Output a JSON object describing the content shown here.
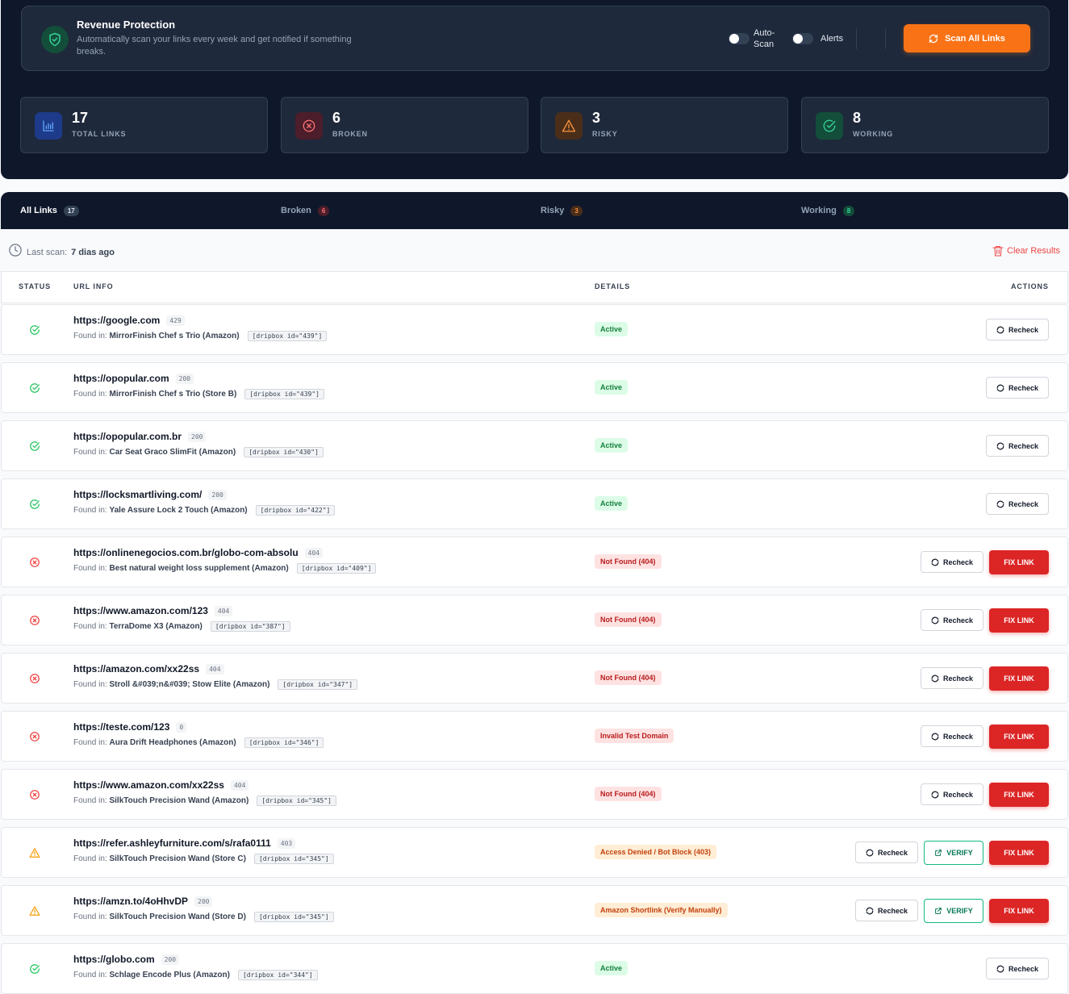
{
  "protection": {
    "title": "Revenue Protection",
    "description": "Automatically scan your links every week and get notified if something breaks.",
    "auto_scan_label": "Auto-Scan",
    "alerts_label": "Alerts",
    "scan_button": "Scan All Links"
  },
  "stats": [
    {
      "value": "17",
      "label": "TOTAL LINKS"
    },
    {
      "value": "6",
      "label": "BROKEN"
    },
    {
      "value": "3",
      "label": "RISKY"
    },
    {
      "value": "8",
      "label": "WORKING"
    }
  ],
  "tabs": [
    {
      "label": "All Links",
      "count": "17"
    },
    {
      "label": "Broken",
      "count": "6"
    },
    {
      "label": "Risky",
      "count": "3"
    },
    {
      "label": "Working",
      "count": "8"
    }
  ],
  "meta": {
    "last_scan_prefix": "Last scan:",
    "last_scan_value": "7 dias ago",
    "clear_results": "Clear Results"
  },
  "table": {
    "headers": {
      "status": "STATUS",
      "url": "URL INFO",
      "details": "DETAILS",
      "actions": "ACTIONS"
    },
    "found_prefix": "Found in:",
    "recheck_label": "Recheck",
    "fix_label": "FIX LINK",
    "verify_label": "VERIFY",
    "rows": [
      {
        "status": "ok",
        "url": "https://google.com",
        "code": "429",
        "found": "MirrorFinish Chef s Trio (Amazon)",
        "shortcode": "[dripbox id=\"439\"]",
        "detail": "Active"
      },
      {
        "status": "ok",
        "url": "https://opopular.com",
        "code": "200",
        "found": "MirrorFinish Chef s Trio (Store B)",
        "shortcode": "[dripbox id=\"439\"]",
        "detail": "Active"
      },
      {
        "status": "ok",
        "url": "https://opopular.com.br",
        "code": "200",
        "found": "Car Seat Graco SlimFit (Amazon)",
        "shortcode": "[dripbox id=\"430\"]",
        "detail": "Active"
      },
      {
        "status": "ok",
        "url": "https://locksmartliving.com/",
        "code": "200",
        "found": "Yale Assure Lock 2 Touch (Amazon)",
        "shortcode": "[dripbox id=\"422\"]",
        "detail": "Active"
      },
      {
        "status": "err",
        "url": "https://onlinenegocios.com.br/globo-com-absolu",
        "code": "404",
        "found": "Best natural weight loss supplement (Amazon)",
        "shortcode": "[dripbox id=\"409\"]",
        "detail": "Not Found (404)"
      },
      {
        "status": "err",
        "url": "https://www.amazon.com/123",
        "code": "404",
        "found": "TerraDome X3 (Amazon)",
        "shortcode": "[dripbox id=\"387\"]",
        "detail": "Not Found (404)"
      },
      {
        "status": "err",
        "url": "https://amazon.com/xx22ss",
        "code": "404",
        "found": "Stroll &#039;n&#039; Stow Elite (Amazon)",
        "shortcode": "[dripbox id=\"347\"]",
        "detail": "Not Found (404)"
      },
      {
        "status": "err",
        "url": "https://teste.com/123",
        "code": "0",
        "found": "Aura Drift Headphones (Amazon)",
        "shortcode": "[dripbox id=\"346\"]",
        "detail": "Invalid Test Domain"
      },
      {
        "status": "err",
        "url": "https://www.amazon.com/xx22ss",
        "code": "404",
        "found": "SilkTouch Precision Wand (Amazon)",
        "shortcode": "[dripbox id=\"345\"]",
        "detail": "Not Found (404)"
      },
      {
        "status": "warn",
        "url": "https://refer.ashleyfurniture.com/s/rafa0111",
        "code": "403",
        "found": "SilkTouch Precision Wand (Store C)",
        "shortcode": "[dripbox id=\"345\"]",
        "detail": "Access Denied / Bot Block (403)"
      },
      {
        "status": "warn",
        "url": "https://amzn.to/4oHhvDP",
        "code": "200",
        "found": "SilkTouch Precision Wand (Store D)",
        "shortcode": "[dripbox id=\"345\"]",
        "detail": "Amazon Shortlink (Verify Manually)"
      },
      {
        "status": "ok",
        "url": "https://globo.com",
        "code": "200",
        "found": "Schlage Encode Plus (Amazon)",
        "shortcode": "[dripbox id=\"344\"]",
        "detail": "Active"
      }
    ]
  },
  "colors": {
    "accent": "#f97316",
    "ok": "#22c55e",
    "error": "#ef4444",
    "warning": "#f59e0b",
    "dark_bg": "#0f172a"
  }
}
